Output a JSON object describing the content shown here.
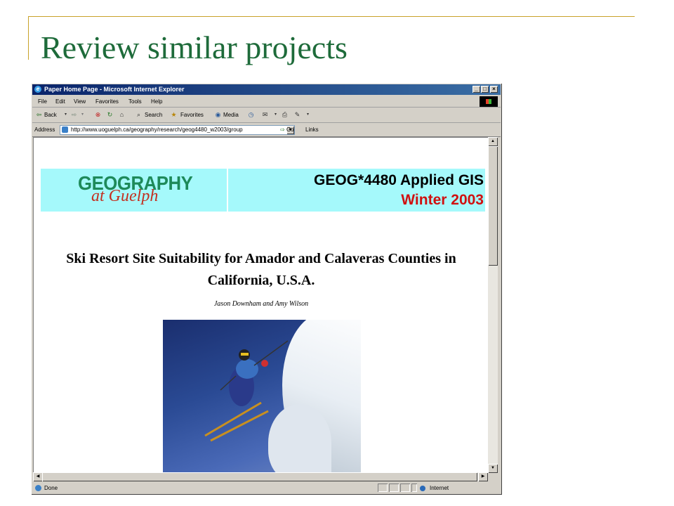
{
  "slide": {
    "title": "Review similar projects",
    "accent_color": "#c8a22a",
    "title_color": "#1e6b3a"
  },
  "browser": {
    "window_title": "Paper Home Page - Microsoft Internet Explorer",
    "window_buttons": {
      "minimize": "_",
      "maximize": "□",
      "close": "×"
    },
    "menu": [
      "File",
      "Edit",
      "View",
      "Favorites",
      "Tools",
      "Help"
    ],
    "toolbar": {
      "back": "Back",
      "search": "Search",
      "favorites": "Favorites",
      "media": "Media"
    },
    "address": {
      "label": "Address",
      "url": "http://www.uoguelph.ca/geography/research/geog4480_w2003/group",
      "go": "Go",
      "links": "Links"
    },
    "status": {
      "text": "Done",
      "zone": "Internet"
    }
  },
  "page": {
    "banner": {
      "logo_line1": "GEOGRAPHY",
      "logo_line2": "at Guelph",
      "course": "GEOG*4480 Applied GIS",
      "term": "Winter 2003",
      "background": "#a5f9fb"
    },
    "project_title": "Ski Resort Site Suitability for Amador and Calaveras Counties in California, U.S.A.",
    "authors": "Jason Downham and Amy Wilson"
  }
}
